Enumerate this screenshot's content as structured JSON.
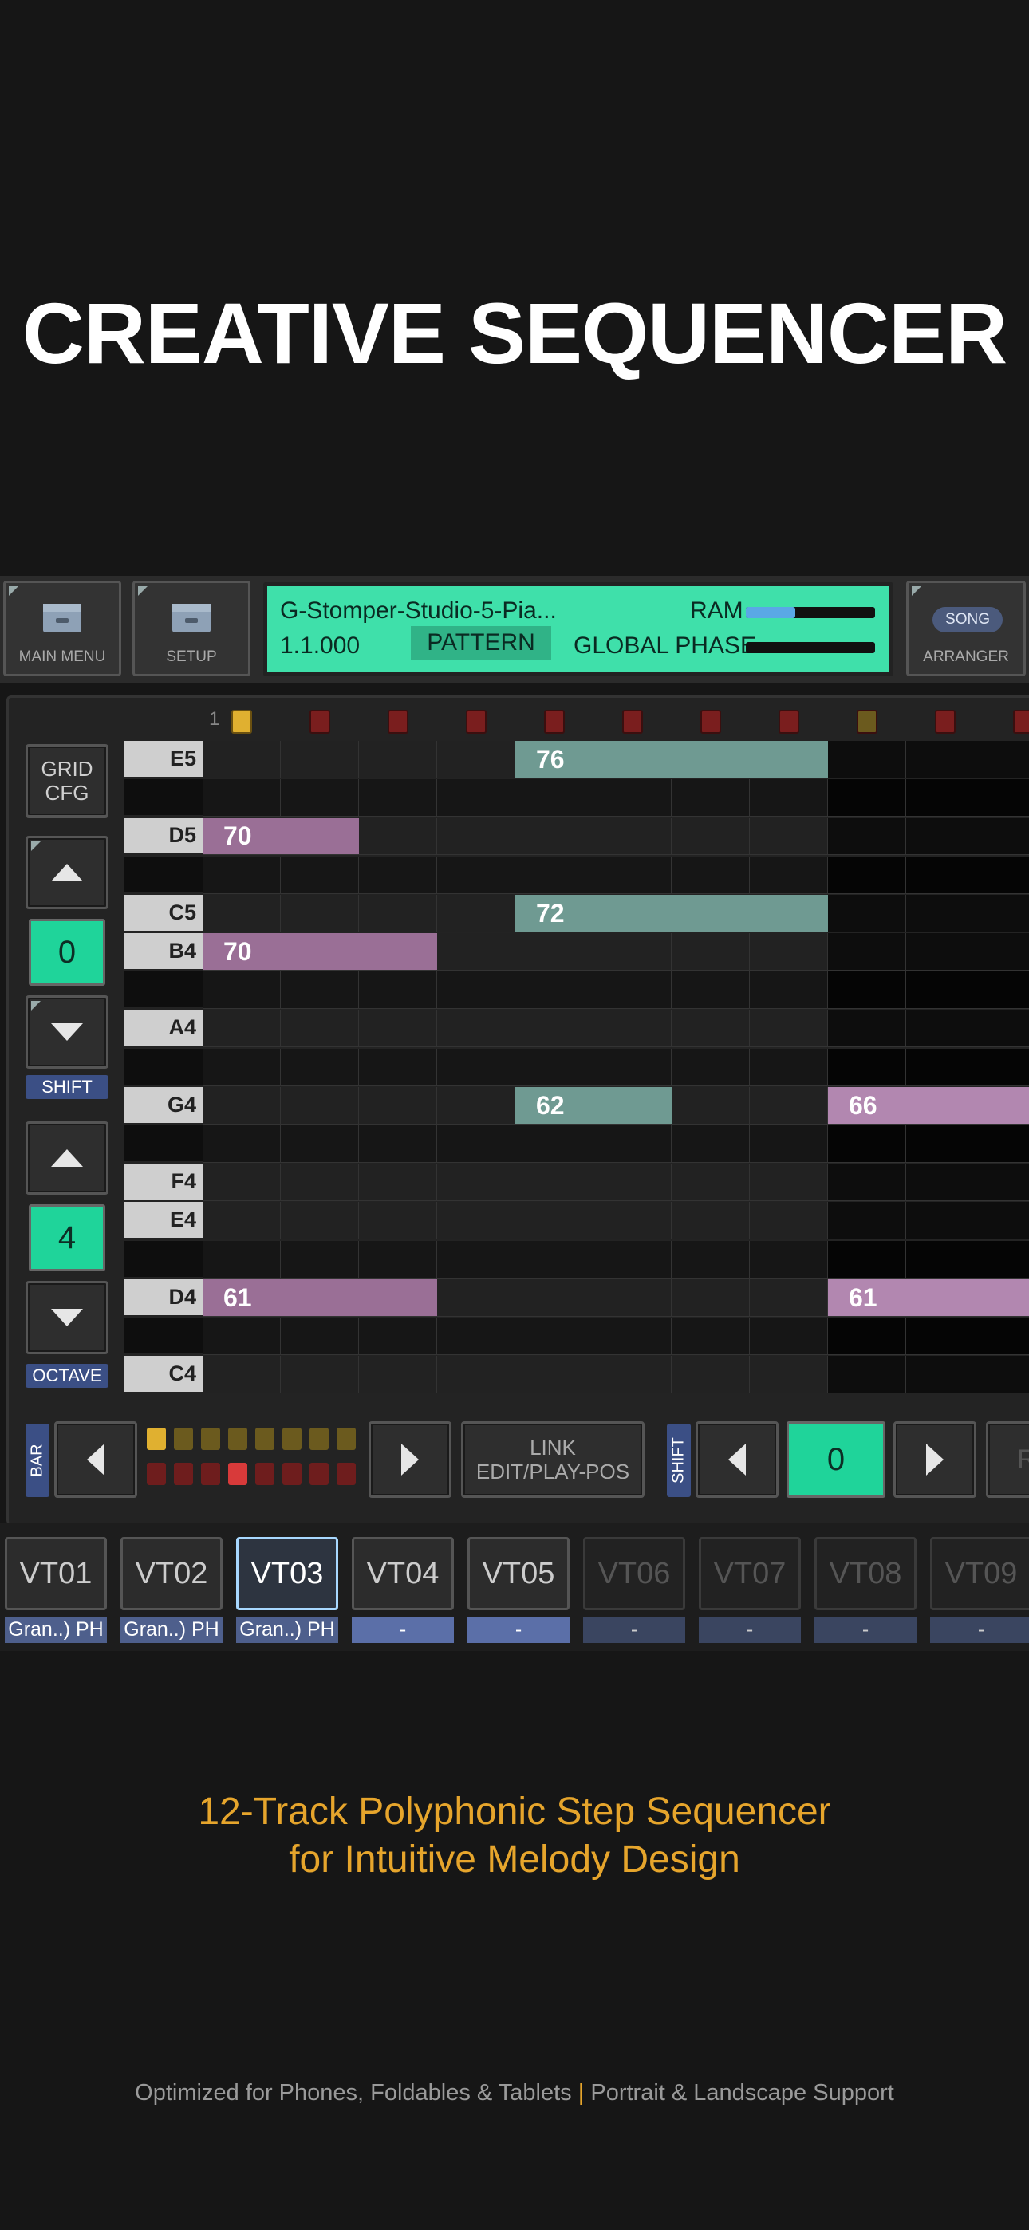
{
  "headline": "CREATIVE SEQUENCER",
  "topbar": {
    "main_menu_label": "MAIN MENU",
    "setup_label": "SETUP",
    "display": {
      "project_name": "G-Stomper-Studio-5-Pia...",
      "position": "1.1.000",
      "mode": "PATTERN",
      "ram_label": "RAM",
      "ram_level": 0.38,
      "global_phase_label": "GLOBAL PHASE",
      "global_phase_level": 0.0
    },
    "song_badge": "SONG",
    "arranger_label": "ARRANGER"
  },
  "sidebar": {
    "grid_cfg_label": "GRID\nCFG",
    "shift_value": "0",
    "shift_label": "SHIFT",
    "octave_value": "4",
    "octave_label": "OCTAVE"
  },
  "step_header": {
    "first_step": "1"
  },
  "grid": {
    "rows": [
      {
        "key": "E5",
        "white": true
      },
      {
        "key": "",
        "white": false
      },
      {
        "key": "D5",
        "white": true
      },
      {
        "key": "",
        "white": false
      },
      {
        "key": "C5",
        "white": true
      },
      {
        "key": "B4",
        "white": true
      },
      {
        "key": "",
        "white": false
      },
      {
        "key": "A4",
        "white": true
      },
      {
        "key": "",
        "white": false
      },
      {
        "key": "G4",
        "white": true
      },
      {
        "key": "",
        "white": false
      },
      {
        "key": "F4",
        "white": true
      },
      {
        "key": "E4",
        "white": true
      },
      {
        "key": "",
        "white": false
      },
      {
        "key": "D4",
        "white": true
      },
      {
        "key": "",
        "white": false
      },
      {
        "key": "C4",
        "white": true
      }
    ],
    "notes": [
      {
        "row": 0,
        "start": 4,
        "length": 4,
        "velocity": "76",
        "color": "#6f9a92"
      },
      {
        "row": 2,
        "start": 0,
        "length": 2,
        "velocity": "70",
        "color": "#9a6f96"
      },
      {
        "row": 4,
        "start": 4,
        "length": 4,
        "velocity": "72",
        "color": "#6f9a92"
      },
      {
        "row": 5,
        "start": 0,
        "length": 3,
        "velocity": "70",
        "color": "#9a6f96"
      },
      {
        "row": 9,
        "start": 4,
        "length": 2,
        "velocity": "62",
        "color": "#6f9a92"
      },
      {
        "row": 9,
        "start": 8,
        "length": 3,
        "velocity": "66",
        "color": "#b287b0"
      },
      {
        "row": 14,
        "start": 0,
        "length": 3,
        "velocity": "61",
        "color": "#9a6f96"
      },
      {
        "row": 14,
        "start": 8,
        "length": 3,
        "velocity": "61",
        "color": "#b287b0"
      }
    ]
  },
  "bottom_controls": {
    "bar_label": "BAR",
    "link_label": "LINK\nEDIT/PLAY-POS",
    "shift_label": "SHIFT",
    "shift_value": "0",
    "edge_letter": "R"
  },
  "tracks": [
    {
      "name": "VT01",
      "sub": "Gran..) PH",
      "state": "normal"
    },
    {
      "name": "VT02",
      "sub": "Gran..) PH",
      "state": "normal"
    },
    {
      "name": "VT03",
      "sub": "Gran..) PH",
      "state": "selected"
    },
    {
      "name": "VT04",
      "sub": "-",
      "state": "normal"
    },
    {
      "name": "VT05",
      "sub": "-",
      "state": "normal"
    },
    {
      "name": "VT06",
      "sub": "-",
      "state": "dim"
    },
    {
      "name": "VT07",
      "sub": "-",
      "state": "dim"
    },
    {
      "name": "VT08",
      "sub": "-",
      "state": "dim"
    },
    {
      "name": "VT09",
      "sub": "-",
      "state": "dim"
    }
  ],
  "subtitle": {
    "line1": "12-Track Polyphonic Step Sequencer",
    "line2": "for Intuitive Melody Design"
  },
  "footer": {
    "left": "Optimized for Phones, Foldables & Tablets",
    "separator": "|",
    "right": "Portrait & Landscape Support"
  },
  "colors": {
    "accent": "#3fe0aa",
    "tag": "#3b4f85",
    "subtitle": "#e6a52c"
  }
}
